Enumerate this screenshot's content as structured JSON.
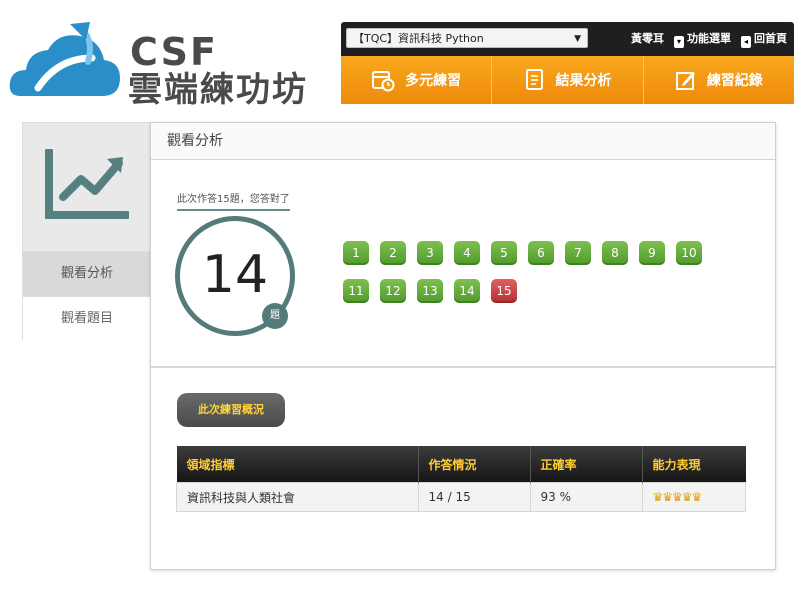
{
  "logo": {
    "line1": "CSF",
    "line2": "雲端練功坊"
  },
  "topbar": {
    "course": "【TQC】資訊科技 Python",
    "user": "黃零耳",
    "menu_label": "功能選單",
    "home_label": "回首頁"
  },
  "nav": {
    "items": [
      {
        "label": "多元練習",
        "icon": "calendar-clock-icon"
      },
      {
        "label": "結果分析",
        "icon": "document-icon"
      },
      {
        "label": "練習紀錄",
        "icon": "edit-icon"
      }
    ]
  },
  "sidebar": {
    "icon": "line-chart-icon",
    "items": [
      {
        "label": "觀看分析",
        "active": true
      },
      {
        "label": "觀看題目",
        "active": false
      }
    ]
  },
  "main": {
    "title": "觀看分析",
    "caption": "此次作答15題，您答對了",
    "score": "14",
    "score_unit": "題",
    "questions": [
      {
        "num": "1",
        "correct": true
      },
      {
        "num": "2",
        "correct": true
      },
      {
        "num": "3",
        "correct": true
      },
      {
        "num": "4",
        "correct": true
      },
      {
        "num": "5",
        "correct": true
      },
      {
        "num": "6",
        "correct": true
      },
      {
        "num": "7",
        "correct": true
      },
      {
        "num": "8",
        "correct": true
      },
      {
        "num": "9",
        "correct": true
      },
      {
        "num": "10",
        "correct": true
      },
      {
        "num": "11",
        "correct": true
      },
      {
        "num": "12",
        "correct": true
      },
      {
        "num": "13",
        "correct": true
      },
      {
        "num": "14",
        "correct": true
      },
      {
        "num": "15",
        "correct": false
      }
    ],
    "overview_button": "此次練習概況",
    "table": {
      "headers": [
        "領域指標",
        "作答情況",
        "正確率",
        "能力表現"
      ],
      "rows": [
        {
          "domain": "資訊科技與人類社會",
          "answered": "14 / 15",
          "accuracy": "93 %",
          "performance": "♛♛♛♛♛",
          "performance_stars": 5
        }
      ]
    }
  },
  "colors": {
    "accent_orange": "#f39a12",
    "correct_green": "#5ba835",
    "wrong_red": "#c43a3a",
    "circle_teal": "#557a7a",
    "header_gold": "#ffcc33"
  }
}
